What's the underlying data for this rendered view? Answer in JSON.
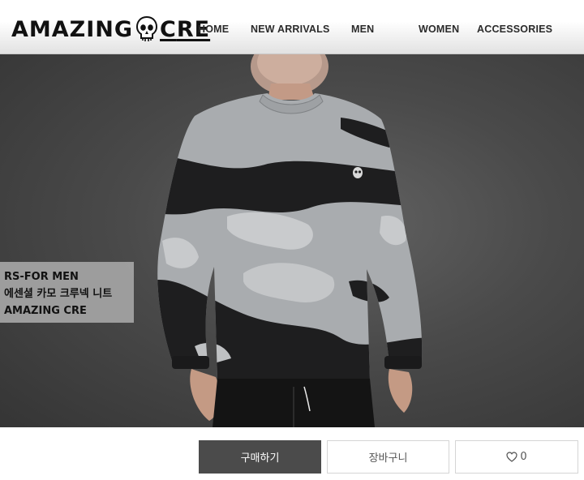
{
  "brand": {
    "logo_left": "AMAZING",
    "logo_right": "RE",
    "logo_letter_o": "C",
    "logo_icon": "skull-icon"
  },
  "nav": {
    "items": [
      {
        "label": "HOME"
      },
      {
        "label": "NEW ARRIVALS"
      },
      {
        "label": "MEN"
      },
      {
        "label": "WOMEN"
      },
      {
        "label": "ACCESSORIES"
      }
    ]
  },
  "hero": {
    "caption": {
      "line1": "RS-FOR MEN",
      "line2": "에센셜 카모 크루넥 니트",
      "line3": "AMAZING CRE"
    }
  },
  "actions": {
    "buy_label": "구매하기",
    "cart_label": "장바구니",
    "like_count": "0",
    "like_icon": "heart-icon"
  },
  "colors": {
    "buy_button_bg": "#4b4b4b",
    "caption_bg": "#a5a5a5",
    "hero_bg": "#4a4a4a"
  }
}
